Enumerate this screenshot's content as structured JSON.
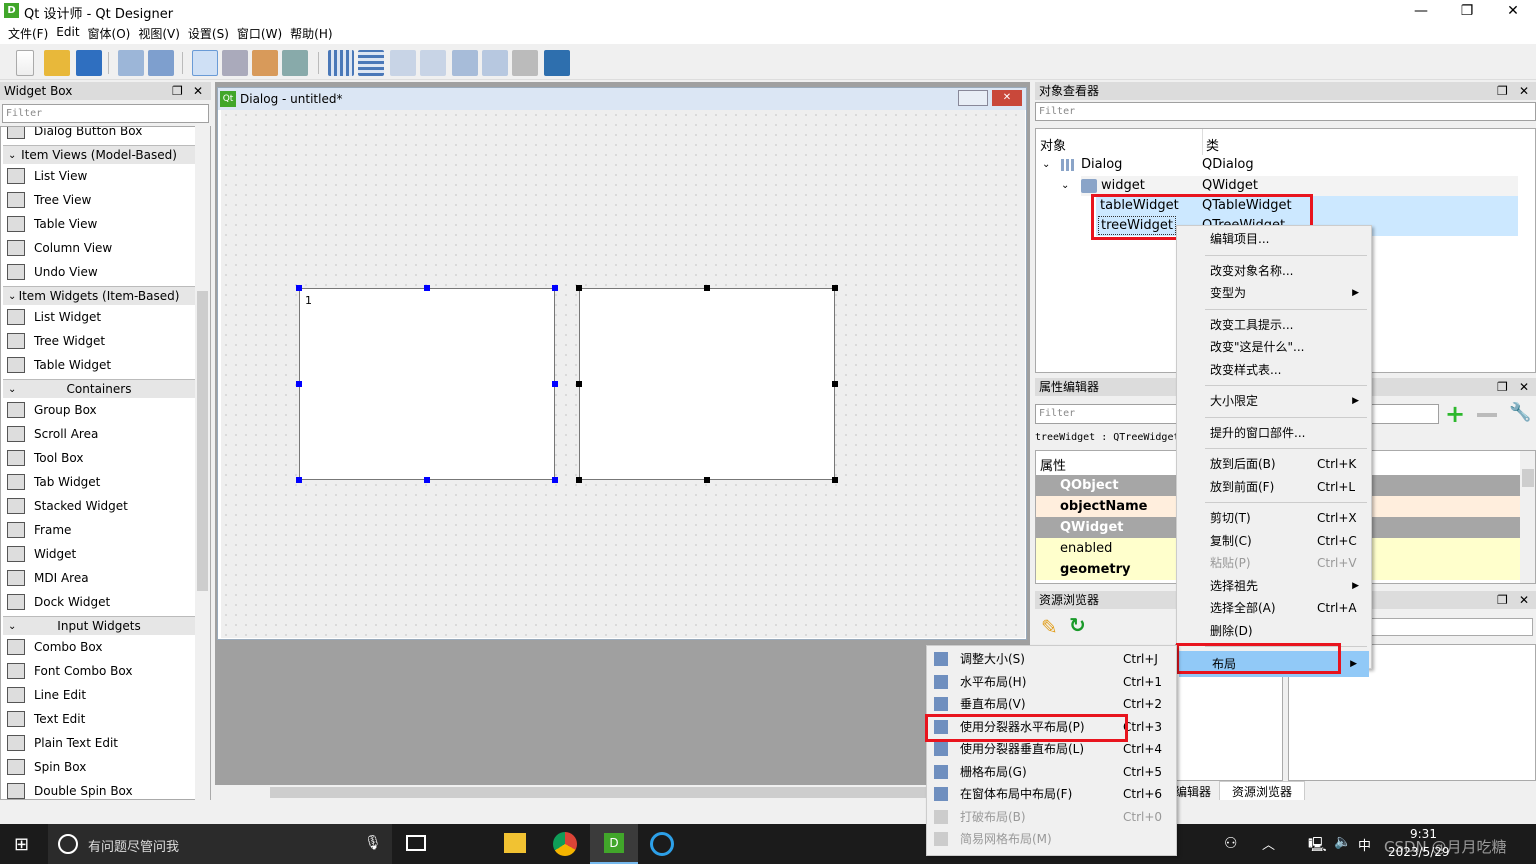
{
  "window": {
    "title": "Qt 设计师 - Qt Designer",
    "app_icon": "D",
    "min": "—",
    "max": "❐",
    "close": "✕"
  },
  "menubar": [
    "文件(F)",
    "Edit",
    "窗体(O)",
    "视图(V)",
    "设置(S)",
    "窗口(W)",
    "帮助(H)"
  ],
  "widget_box": {
    "title": "Widget Box",
    "filter_placeholder": "Filter",
    "items": [
      {
        "type": "item",
        "label": "Dialog Button Box"
      },
      {
        "type": "cat",
        "label": "Item Views (Model-Based)"
      },
      {
        "type": "item",
        "label": "List View"
      },
      {
        "type": "item",
        "label": "Tree View"
      },
      {
        "type": "item",
        "label": "Table View"
      },
      {
        "type": "item",
        "label": "Column View"
      },
      {
        "type": "item",
        "label": "Undo View"
      },
      {
        "type": "cat",
        "label": "Item Widgets (Item-Based)"
      },
      {
        "type": "item",
        "label": "List Widget"
      },
      {
        "type": "item",
        "label": "Tree Widget"
      },
      {
        "type": "item",
        "label": "Table Widget"
      },
      {
        "type": "cat",
        "label": "Containers"
      },
      {
        "type": "item",
        "label": "Group Box"
      },
      {
        "type": "item",
        "label": "Scroll Area"
      },
      {
        "type": "item",
        "label": "Tool Box"
      },
      {
        "type": "item",
        "label": "Tab Widget"
      },
      {
        "type": "item",
        "label": "Stacked Widget"
      },
      {
        "type": "item",
        "label": "Frame"
      },
      {
        "type": "item",
        "label": "Widget"
      },
      {
        "type": "item",
        "label": "MDI Area"
      },
      {
        "type": "item",
        "label": "Dock Widget"
      },
      {
        "type": "cat",
        "label": "Input Widgets"
      },
      {
        "type": "item",
        "label": "Combo Box"
      },
      {
        "type": "item",
        "label": "Font Combo Box"
      },
      {
        "type": "item",
        "label": "Line Edit"
      },
      {
        "type": "item",
        "label": "Text Edit"
      },
      {
        "type": "item",
        "label": "Plain Text Edit"
      },
      {
        "type": "item",
        "label": "Spin Box"
      },
      {
        "type": "item",
        "label": "Double Spin Box"
      }
    ]
  },
  "dialog": {
    "title": "Dialog - untitled*",
    "table_cell": "1"
  },
  "object_inspector": {
    "title": "对象查看器",
    "filter_placeholder": "Filter",
    "col_object": "对象",
    "col_class": "类",
    "rows": [
      {
        "name": "Dialog",
        "cls": "QDialog"
      },
      {
        "name": "widget",
        "cls": "QWidget"
      },
      {
        "name": "tableWidget",
        "cls": "QTableWidget"
      },
      {
        "name": "treeWidget",
        "cls": "QTreeWidget"
      }
    ]
  },
  "property_editor": {
    "title": "属性编辑器",
    "filter_placeholder": "Filter",
    "selected": "treeWidget : QTreeWidget",
    "col_prop": "属性",
    "rows": [
      {
        "label": "QObject",
        "kind": "group"
      },
      {
        "label": "objectName",
        "kind": "bold"
      },
      {
        "label": "QWidget",
        "kind": "group"
      },
      {
        "label": "enabled",
        "kind": "normal"
      },
      {
        "label": "geometry",
        "kind": "bold"
      }
    ]
  },
  "resource_browser": {
    "title": "资源浏览器"
  },
  "bottom_tabs": [
    "编辑器",
    "资源浏览器"
  ],
  "context_menu": {
    "items": [
      {
        "label": "编辑项目..."
      },
      {
        "sep": true
      },
      {
        "label": "改变对象名称..."
      },
      {
        "label": "变型为",
        "sub": true
      },
      {
        "sep": true
      },
      {
        "label": "改变工具提示..."
      },
      {
        "label": "改变\"这是什么\"..."
      },
      {
        "label": "改变样式表..."
      },
      {
        "sep": true
      },
      {
        "label": "大小限定",
        "sub": true
      },
      {
        "sep": true
      },
      {
        "label": "提升的窗口部件..."
      },
      {
        "sep": true
      },
      {
        "label": "放到后面(B)",
        "shortcut": "Ctrl+K"
      },
      {
        "label": "放到前面(F)",
        "shortcut": "Ctrl+L"
      },
      {
        "sep": true
      },
      {
        "label": "剪切(T)",
        "shortcut": "Ctrl+X"
      },
      {
        "label": "复制(C)",
        "shortcut": "Ctrl+C"
      },
      {
        "label": "粘贴(P)",
        "shortcut": "Ctrl+V",
        "disabled": true
      },
      {
        "label": "选择祖先",
        "sub": true
      },
      {
        "label": "选择全部(A)",
        "shortcut": "Ctrl+A"
      },
      {
        "label": "删除(D)"
      },
      {
        "sep": true
      },
      {
        "label": "布局",
        "sub": true,
        "highlighted": true
      }
    ]
  },
  "layout_submenu": {
    "items": [
      {
        "label": "调整大小(S)",
        "shortcut": "Ctrl+J"
      },
      {
        "label": "水平布局(H)",
        "shortcut": "Ctrl+1"
      },
      {
        "label": "垂直布局(V)",
        "shortcut": "Ctrl+2"
      },
      {
        "label": "使用分裂器水平布局(P)",
        "shortcut": "Ctrl+3",
        "boxed": true
      },
      {
        "label": "使用分裂器垂直布局(L)",
        "shortcut": "Ctrl+4"
      },
      {
        "label": "栅格布局(G)",
        "shortcut": "Ctrl+5"
      },
      {
        "label": "在窗体布局中布局(F)",
        "shortcut": "Ctrl+6"
      },
      {
        "label": "打破布局(B)",
        "shortcut": "Ctrl+0",
        "disabled": true
      },
      {
        "label": "简易网格布局(M)",
        "disabled": true
      }
    ]
  },
  "taskbar": {
    "search_placeholder": "有问题尽管问我",
    "time": "9:31",
    "date": "2023/5/29",
    "ime": "中",
    "watermark": "CSDN @月月吃糖"
  },
  "colors": {
    "highlight": "#91c9f7",
    "selection": "#cce8ff",
    "red_box": "#e8141e",
    "group_row": "#a6a6a6",
    "prop_yellow": "#ffffcc",
    "prop_orange": "#ffeedd"
  }
}
